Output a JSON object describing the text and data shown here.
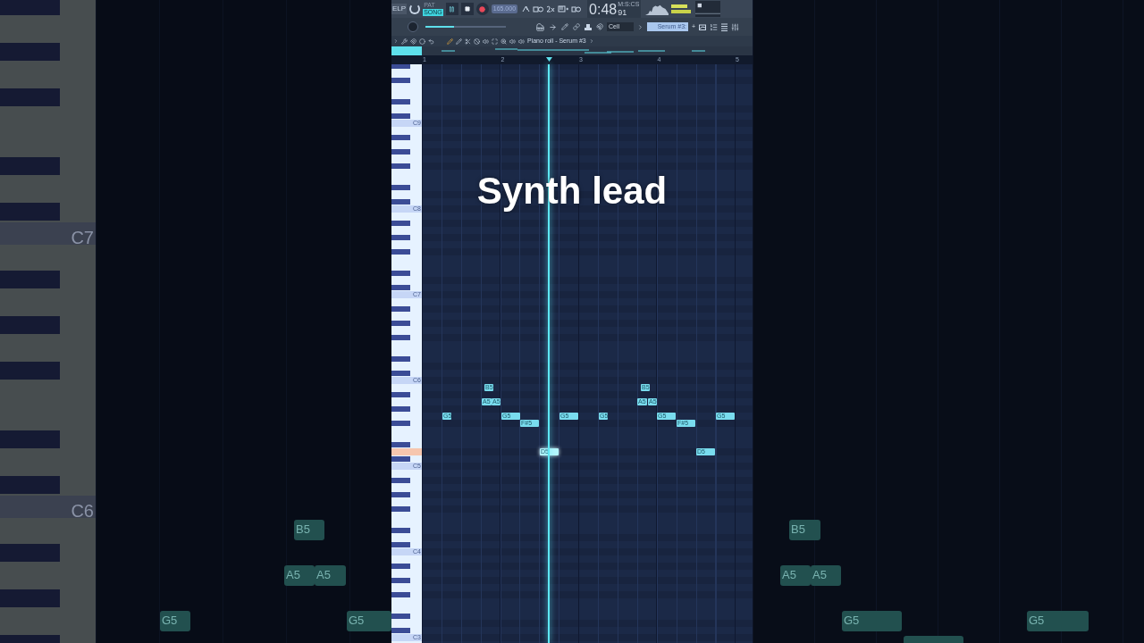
{
  "backdrop_left": {
    "key_labels": [
      "C7",
      "C6"
    ],
    "notes": [
      {
        "label": "G5"
      },
      {
        "label": "A5"
      },
      {
        "label": "B5"
      },
      {
        "label": "A5"
      },
      {
        "label": "G5"
      }
    ]
  },
  "toolbar": {
    "help_label": "ELP",
    "mode_toggle": [
      {
        "label": "PAT",
        "selected": false
      },
      {
        "label": "SONG",
        "selected": true
      }
    ],
    "playing": true,
    "tempo": "165.000",
    "time_format": "M:S:CS",
    "time_main": "0:48",
    "time_fraction": "91",
    "master_slider": {
      "level": 0.35
    },
    "snap": "Cell",
    "channel": "Serum #3:",
    "channel_add": "+"
  },
  "piano_roll": {
    "title": "Piano roll - Serum #3",
    "ruler": [
      "1",
      "2",
      "3",
      "4",
      "5"
    ],
    "key_labels": [
      "C9",
      "C8",
      "C7",
      "C6",
      "C5",
      "C4",
      "C3"
    ],
    "caption": "Synth lead",
    "notes": [
      {
        "label": "G5",
        "playing": false
      },
      {
        "label": "A5",
        "playing": false
      },
      {
        "label": "B5",
        "playing": false
      },
      {
        "label": "A5",
        "playing": false
      },
      {
        "label": "G5",
        "playing": false
      },
      {
        "label": "F#5",
        "playing": false
      },
      {
        "label": "D5",
        "playing": true
      },
      {
        "label": "G5",
        "playing": false
      },
      {
        "label": "G5",
        "playing": false
      },
      {
        "label": "A5",
        "playing": false
      },
      {
        "label": "B5",
        "playing": false
      },
      {
        "label": "A5",
        "playing": false
      },
      {
        "label": "G5",
        "playing": false
      },
      {
        "label": "F#5",
        "playing": false
      },
      {
        "label": "D5",
        "playing": false
      },
      {
        "label": "G5",
        "playing": false
      }
    ]
  },
  "backdrop_right": {
    "notes": [
      {
        "label": "A5"
      },
      {
        "label": "B5"
      },
      {
        "label": "A5"
      },
      {
        "label": "G5"
      },
      {
        "label": "G5"
      }
    ]
  }
}
